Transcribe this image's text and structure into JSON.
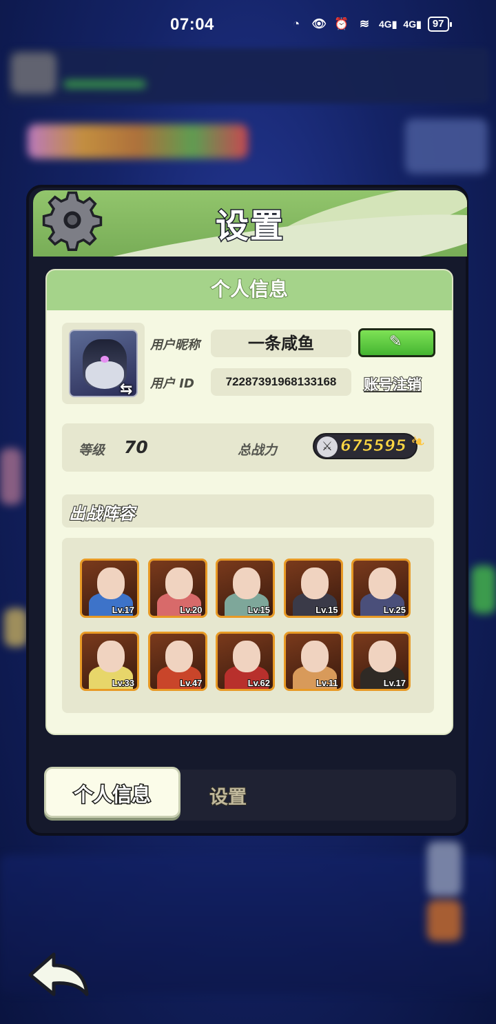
{
  "status_bar": {
    "time": "07:04",
    "icons": [
      "data-saver-icon",
      "eye-icon",
      "alarm-icon",
      "wifi-6-icon",
      "signal-4g-icon",
      "signal-4g-icon-2"
    ],
    "signal1": "4G",
    "signal2": "4G",
    "battery": "97"
  },
  "dialog": {
    "title": "设置",
    "panel_title": "个人信息",
    "nickname_label": "用户昵称",
    "nickname": "一条咸鱼",
    "id_label": "用户 ID",
    "user_id": "72287391968133168",
    "cancel_account": "账号注销",
    "level_label": "等级",
    "level": "70",
    "power_label": "总战力",
    "power": "675595",
    "lineup_title": "出战阵容",
    "heroes": [
      {
        "level": "Lv.17",
        "color": "#3d73c9"
      },
      {
        "level": "Lv.20",
        "color": "#d86a6a"
      },
      {
        "level": "Lv.15",
        "color": "#7ea79a"
      },
      {
        "level": "Lv.15",
        "color": "#3a3a48"
      },
      {
        "level": "Lv.25",
        "color": "#4a4f7a"
      },
      {
        "level": "Lv.33",
        "color": "#e7d66a"
      },
      {
        "level": "Lv.47",
        "color": "#c9452a"
      },
      {
        "level": "Lv.62",
        "color": "#b8302c"
      },
      {
        "level": "Lv.11",
        "color": "#d89a5a"
      },
      {
        "level": "Lv.17",
        "color": "#2f2a25"
      }
    ],
    "tabs": {
      "active": "个人信息",
      "inactive": "设置"
    }
  },
  "colors": {
    "header_green": "#86ba60",
    "panel_bg": "#f5f8e2",
    "accent_green": "#58c23a",
    "power_gold": "#ffd743",
    "hero_frame": "#e89a25"
  }
}
